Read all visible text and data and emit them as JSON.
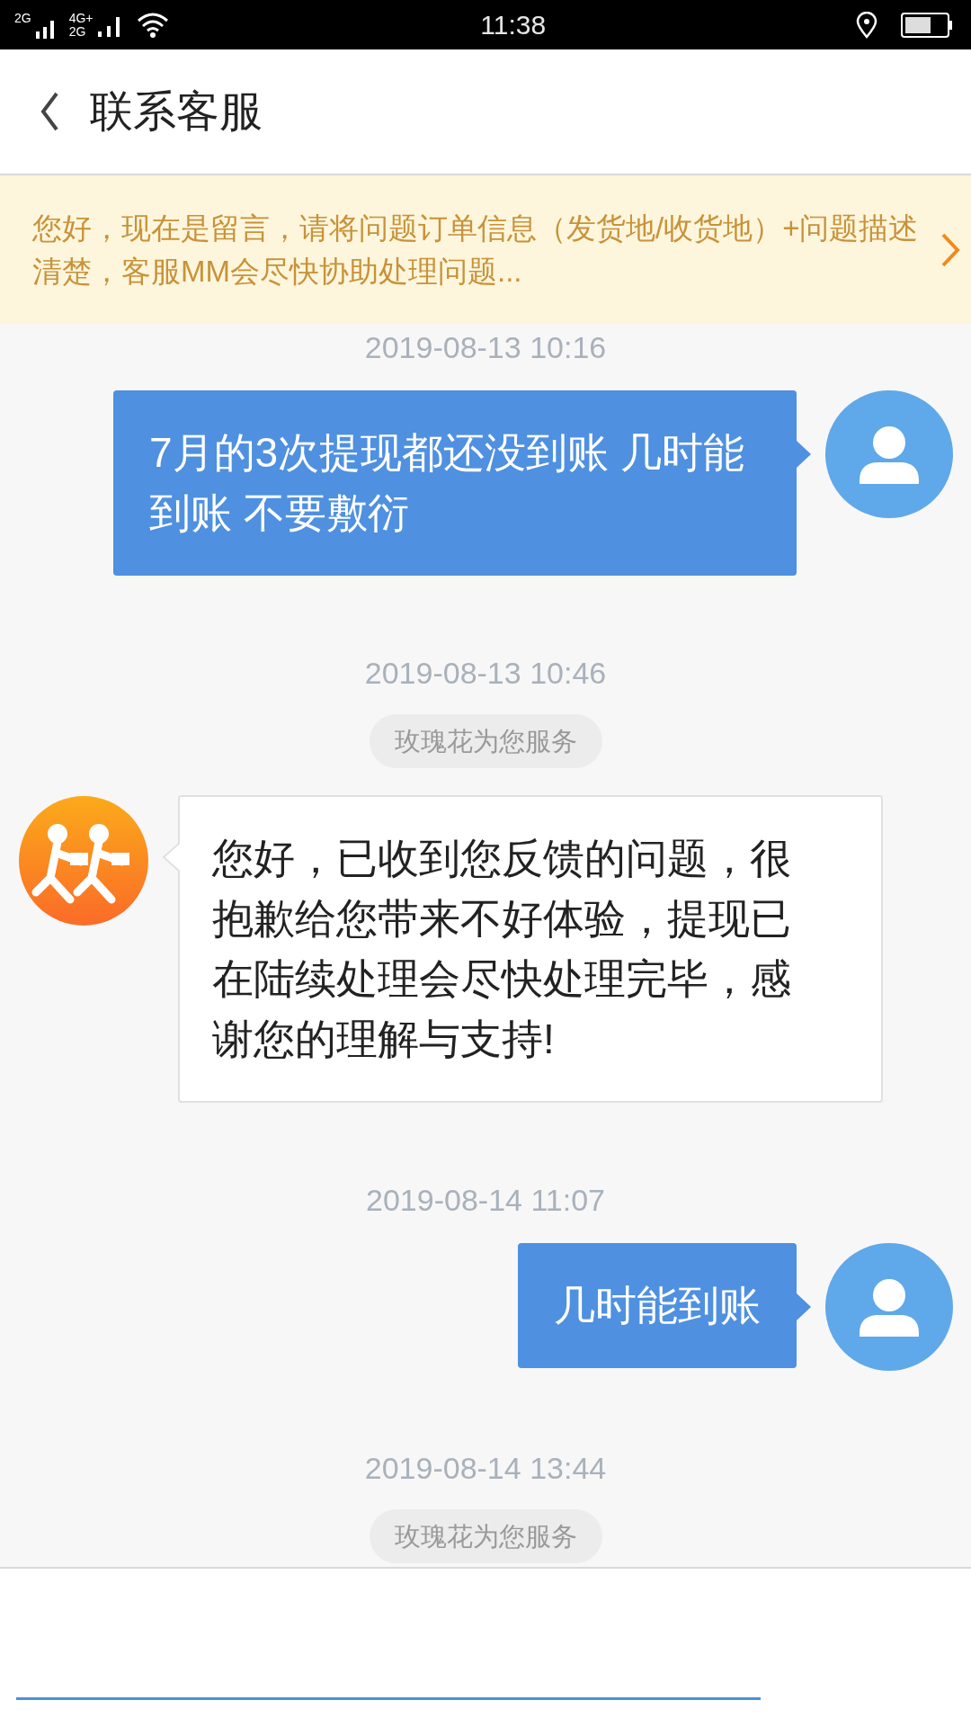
{
  "status_bar": {
    "signal_1": "2G",
    "signal_2_top": "4G+",
    "signal_2_bottom": "2G",
    "time": "11:38"
  },
  "header": {
    "title": "联系客服"
  },
  "notice": {
    "text": "您好，现在是留言，请将问题订单信息（发货地/收货地）+问题描述清楚，客服MM会尽快协助处理问题..."
  },
  "messages": [
    {
      "kind": "time",
      "text": "2019-08-13 10:16"
    },
    {
      "kind": "user",
      "text": "7月的3次提现都还没到账 几时能到账 不要敷衍"
    },
    {
      "kind": "time",
      "text": "2019-08-13 10:46"
    },
    {
      "kind": "agent_tag",
      "text": "玫瑰花为您服务"
    },
    {
      "kind": "agent",
      "text": "您好，已收到您反馈的问题，很抱歉给您带来不好体验，提现已在陆续处理会尽快处理完毕，感谢您的理解与支持!"
    },
    {
      "kind": "time",
      "text": "2019-08-14 11:07"
    },
    {
      "kind": "user",
      "text": "几时能到账"
    },
    {
      "kind": "time",
      "text": "2019-08-14 13:44"
    },
    {
      "kind": "agent_tag",
      "text": "玫瑰花为您服务"
    }
  ]
}
